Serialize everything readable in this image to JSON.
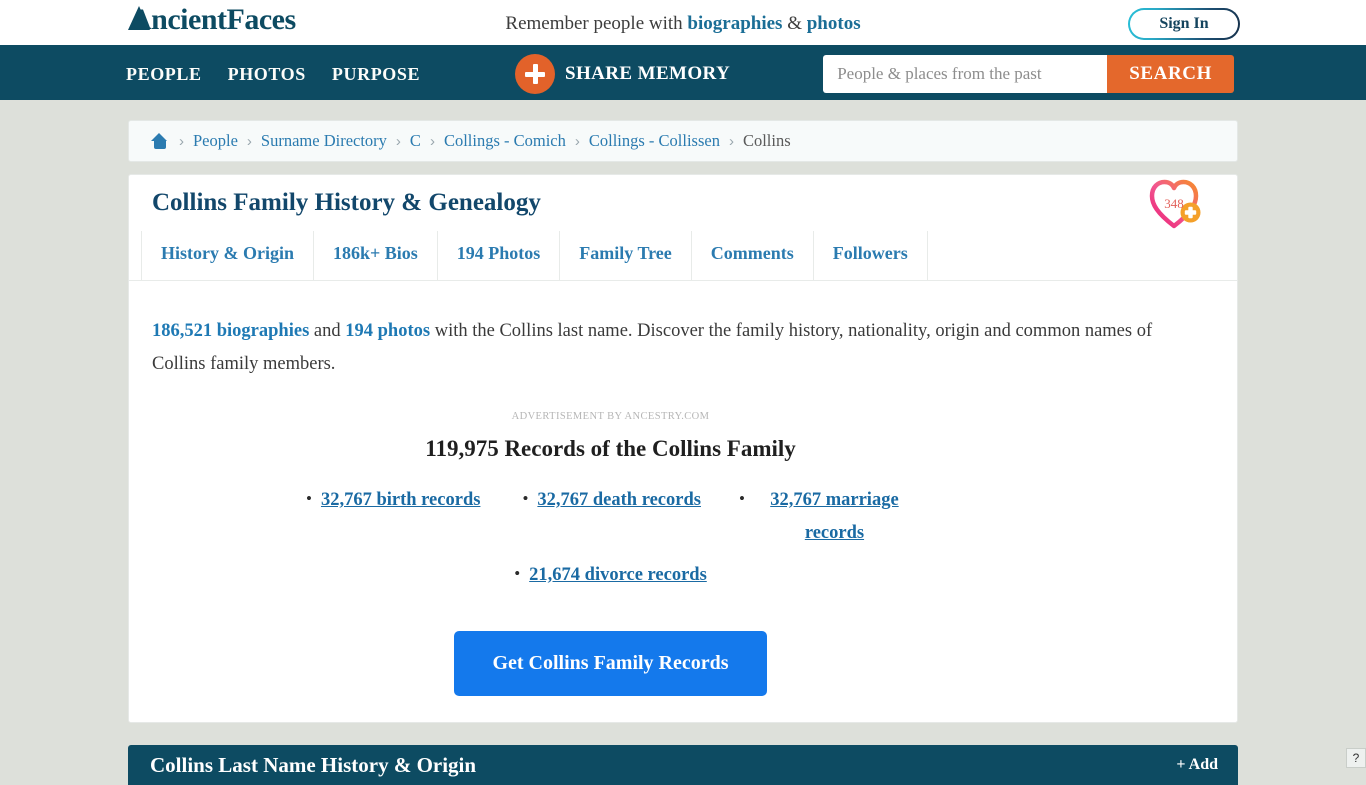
{
  "header": {
    "logo_text": "AncientFaces",
    "logo_icon": "mountain-a-mark",
    "tagline_prefix": "Remember people with ",
    "tagline_bold1": "biographies",
    "tagline_amp": " & ",
    "tagline_bold2": "photos",
    "signin_label": "Sign In"
  },
  "nav": {
    "links": [
      {
        "label": "PEOPLE"
      },
      {
        "label": "PHOTOS"
      },
      {
        "label": "PURPOSE"
      }
    ],
    "share_memory_label": "SHARE MEMORY",
    "share_memory_icon": "plus-circle-icon",
    "search": {
      "placeholder": "People & places from the past",
      "value": "",
      "button_label": "SEARCH"
    }
  },
  "breadcrumb": {
    "home_icon": "home-icon",
    "separator": "›",
    "items": [
      {
        "label": "People",
        "current": false
      },
      {
        "label": "Surname Directory",
        "current": false
      },
      {
        "label": "C",
        "current": false
      },
      {
        "label": "Collings - Comich",
        "current": false
      },
      {
        "label": "Collings - Collissen",
        "current": false
      },
      {
        "label": "Collins",
        "current": true
      }
    ]
  },
  "page": {
    "title": "Collins Family History & Genealogy",
    "follow_badge": {
      "count": "348",
      "icon": "heart-plus-icon"
    },
    "tabs": [
      {
        "label": "History & Origin"
      },
      {
        "label": "186k+ Bios"
      },
      {
        "label": "194 Photos"
      },
      {
        "label": "Family Tree"
      },
      {
        "label": "Comments"
      },
      {
        "label": "Followers"
      }
    ],
    "intro": {
      "link_bios": "186,521 biographies",
      "mid": " and ",
      "link_photos": "194 photos",
      "rest": " with the Collins last name. Discover the family history, nationality, origin and common names of Collins family members."
    },
    "ad": {
      "label": "ADVERTISEMENT BY ANCESTRY.COM",
      "title": "119,975 Records of the Collins Family",
      "records_row1": [
        {
          "label": "32,767 birth records"
        },
        {
          "label": "32,767 death records"
        },
        {
          "label": "32,767 marriage  records"
        }
      ],
      "records_row2": [
        {
          "label": "21,674 divorce records"
        }
      ],
      "cta_label": "Get Collins Family Records"
    }
  },
  "bottom_section": {
    "title": "Collins Last Name History & Origin",
    "add_label": "+ Add",
    "help_label": "?"
  },
  "colors": {
    "nav_teal": "#0d4b62",
    "orange": "#e2622a",
    "link_blue": "#2b7bb0",
    "cta_blue": "#1479ec",
    "page_bg": "#dde0da",
    "heart_pink": "#ea1e78",
    "heart_orange": "#f68b2c"
  }
}
